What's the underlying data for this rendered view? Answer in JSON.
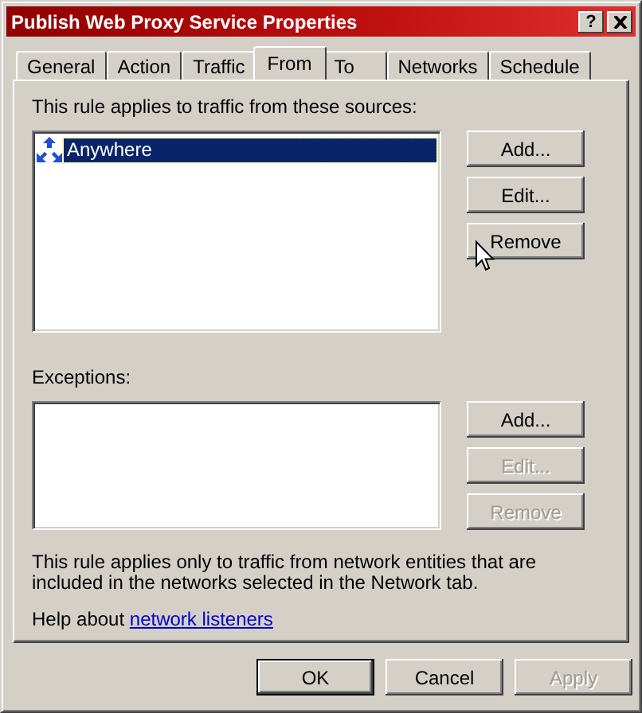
{
  "window": {
    "title": "Publish Web Proxy Service Properties",
    "help_button": "?"
  },
  "tabs": [
    {
      "label": "General",
      "selected": false
    },
    {
      "label": "Action",
      "selected": false
    },
    {
      "label": "Traffic",
      "selected": false
    },
    {
      "label": "From",
      "selected": true
    },
    {
      "label": "To",
      "selected": false
    },
    {
      "label": "Networks",
      "selected": false
    },
    {
      "label": "Schedule",
      "selected": false
    }
  ],
  "sources": {
    "label": "This rule applies to traffic from these sources:",
    "items": [
      {
        "name": "Anywhere",
        "selected": true
      }
    ],
    "buttons": [
      {
        "label": "Add...",
        "disabled": false
      },
      {
        "label": "Edit...",
        "disabled": false
      },
      {
        "label": "Remove",
        "disabled": false
      }
    ]
  },
  "exceptions": {
    "label": "Exceptions:",
    "buttons": [
      {
        "label": "Add...",
        "disabled": false
      },
      {
        "label": "Edit...",
        "disabled": true
      },
      {
        "label": "Remove",
        "disabled": true
      }
    ]
  },
  "note": "This rule applies only to traffic from network entities that are included in the networks selected in the Network tab.",
  "help": {
    "text": "Help about",
    "link": "network listeners"
  },
  "footer_buttons": [
    {
      "label": "OK",
      "default": true,
      "disabled": false
    },
    {
      "label": "Cancel",
      "default": false,
      "disabled": false
    },
    {
      "label": "Apply",
      "default": false,
      "disabled": true
    }
  ]
}
